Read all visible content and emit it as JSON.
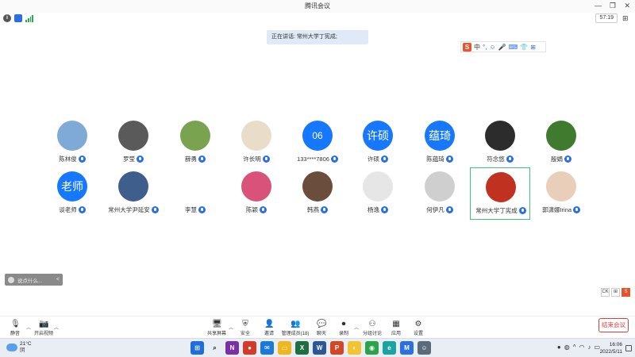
{
  "window": {
    "title": "腾讯会议",
    "minimize": "—",
    "maximize": "❐",
    "close": "✕"
  },
  "status": {
    "info": "i",
    "timer": "57:19",
    "grid": "⊞"
  },
  "speaking": "正在讲话: 常州大学丁宪成;",
  "ime_bar": {
    "logo": "S",
    "mode": "中",
    "items": [
      "°,",
      "☺",
      "🎤",
      "⌨",
      "👕",
      "⊞"
    ]
  },
  "participants_row1": [
    {
      "name": "陈林俊",
      "avatar": "tree",
      "bg": "#7fa9d6"
    },
    {
      "name": "罗莹",
      "avatar": "photo",
      "bg": "#5a5a5a"
    },
    {
      "name": "薛勇",
      "avatar": "road",
      "bg": "#7aa34f"
    },
    {
      "name": "许长明",
      "avatar": "cartoon",
      "bg": "#e9dcc8"
    },
    {
      "name": "133****7806",
      "avatar_text": "06",
      "bg": "#1677ff"
    },
    {
      "name": "许硕",
      "avatar_text": "许硕",
      "bg": "#1677ff"
    },
    {
      "name": "陈蕴琦",
      "avatar_text": "蕴琦",
      "bg": "#1677ff"
    },
    {
      "name": "符念悠",
      "avatar": "night",
      "bg": "#2c2c2c"
    },
    {
      "name": "殷娟",
      "avatar": "plant",
      "bg": "#3f7a2e"
    }
  ],
  "participants_row2": [
    {
      "name": "谈老师",
      "avatar_text": "老师",
      "bg": "#1677ff"
    },
    {
      "name": "常州大学尹延安",
      "avatar": "building",
      "bg": "#3f5e8c"
    },
    {
      "name": "李慧",
      "avatar": "cartoon2",
      "bg": "#ffffff"
    },
    {
      "name": "陈颖",
      "avatar": "flower",
      "bg": "#d8527a"
    },
    {
      "name": "韩燕",
      "avatar": "dark",
      "bg": "#6b4d3d"
    },
    {
      "name": "杨逸",
      "avatar": "panda",
      "bg": "#e6e6e6"
    },
    {
      "name": "何伊凡",
      "avatar": "cat",
      "bg": "#cfcfcf"
    },
    {
      "name": "常州大学丁宪成",
      "avatar": "seal",
      "bg": "#c0311f",
      "active": true
    },
    {
      "name": "郭潇娜Irina",
      "avatar": "girl",
      "bg": "#e9cfb9"
    }
  ],
  "chat": {
    "placeholder": "说点什么...",
    "chevron": "<"
  },
  "ime_small": [
    "CK",
    "⊞",
    "S"
  ],
  "toolbar": {
    "mute": "静音",
    "video": "开启视频",
    "share": "共享屏幕",
    "security": "安全",
    "invite": "邀请",
    "manage": "管理成员(18)",
    "chat": "聊天",
    "record": "录制",
    "breakout": "分组讨论",
    "apps": "应用",
    "settings": "设置",
    "end": "结束会议"
  },
  "taskbar": {
    "weather_temp": "21°C",
    "weather_desc": "阴",
    "time": "16:06",
    "date": "2022/5/11",
    "tray_caret": "^"
  }
}
